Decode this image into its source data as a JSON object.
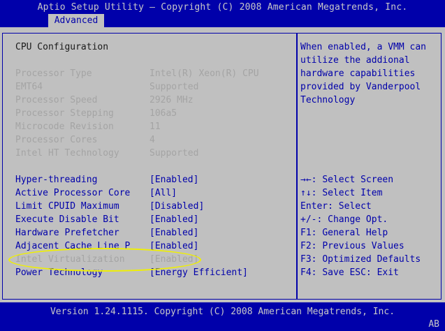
{
  "header": {
    "title": "Aptio Setup Utility – Copyright (C) 2008 American Megatrends, Inc.",
    "tab": "Advanced"
  },
  "section_title": "CPU Configuration",
  "info": [
    {
      "label": "Processor Type",
      "value": "Intel(R) Xeon(R) CPU"
    },
    {
      "label": "EMT64",
      "value": "Supported"
    },
    {
      "label": "Processor Speed",
      "value": "2926 MHz"
    },
    {
      "label": "Processor Stepping",
      "value": "106a5"
    },
    {
      "label": "Microcode Revision",
      "value": "11"
    },
    {
      "label": "Processor Cores",
      "value": "4"
    },
    {
      "label": "Intel HT Technology",
      "value": "Supported"
    }
  ],
  "settings": [
    {
      "label": "Hyper-threading",
      "value": "[Enabled]"
    },
    {
      "label": "Active Processor Core",
      "value": "[All]"
    },
    {
      "label": "Limit CPUID Maximum",
      "value": "[Disabled]"
    },
    {
      "label": "Execute Disable Bit",
      "value": "[Enabled]"
    },
    {
      "label": "Hardware Prefetcher",
      "value": "[Enabled]"
    },
    {
      "label": "Adjacent Cache Line P",
      "value": "[Enabled]"
    },
    {
      "label": "Intel Virtualization",
      "value": "[Enabled]"
    },
    {
      "label": "Power Technology",
      "value": "[Energy Efficient]"
    }
  ],
  "help": {
    "lines": [
      "When enabled, a VMM can",
      "utilize the addional",
      "hardware capabilities",
      "provided by Vanderpool",
      "Technology"
    ]
  },
  "keys": [
    {
      "key": "→←:",
      "action": "Select Screen"
    },
    {
      "key": "↑↓:",
      "action": "Select Item"
    },
    {
      "key": "Enter:",
      "action": "Select"
    },
    {
      "key": "+/-:",
      "action": "Change Opt."
    },
    {
      "key": "F1:",
      "action": "General Help"
    },
    {
      "key": "F2:",
      "action": "Previous Values"
    },
    {
      "key": "F3:",
      "action": "Optimized Defaults"
    },
    {
      "key": "F4:",
      "action": "Save  ESC: Exit"
    }
  ],
  "footer": {
    "version": "Version 1.24.1115. Copyright (C) 2008 American Megatrends, Inc.",
    "badge": "AB"
  },
  "colors": {
    "background_blue": "#0000aa",
    "panel_gray": "#c0c0c0",
    "disabled_gray": "#a4a4a4",
    "highlight_oval": "#f0f000"
  }
}
